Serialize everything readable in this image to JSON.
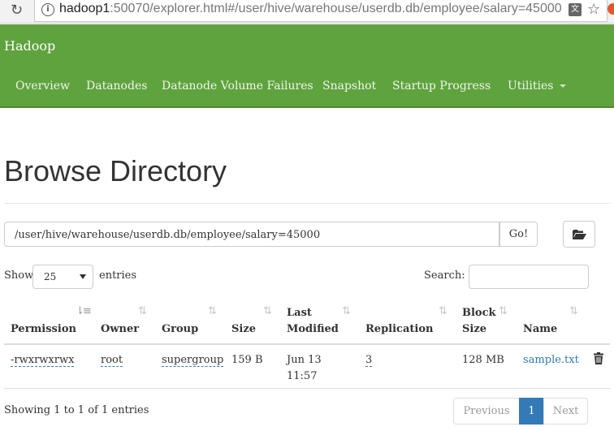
{
  "browser": {
    "url_host": "hadoop1",
    "url_rest": ":50070/explorer.html#/user/hive/warehouse/userdb.db/employee/salary=45000",
    "translate_glyph": "文"
  },
  "navbar": {
    "brand": "Hadoop",
    "items": [
      "Overview",
      "Datanodes",
      "Datanode Volume Failures",
      "Snapshot",
      "Startup Progress",
      "Utilities"
    ]
  },
  "page": {
    "title": "Browse Directory",
    "path_value": "/user/hive/warehouse/userdb.db/employee/salary=45000",
    "go_label": "Go!"
  },
  "controls": {
    "show_label": "Show",
    "entries_value": "25",
    "entries_label": "entries",
    "search_label": "Search:"
  },
  "table": {
    "headers": {
      "permission": "Permission",
      "owner": "Owner",
      "group": "Group",
      "size": "Size",
      "last_modified_1": "Last",
      "last_modified_2": "Modified",
      "replication": "Replication",
      "block_size_1": "Block",
      "block_size_2": "Size",
      "name": "Name"
    },
    "rows": [
      {
        "permission": "-rwxrwxrwx",
        "owner": "root",
        "group": "supergroup",
        "size": "159 B",
        "modified_1": "Jun 13",
        "modified_2": "11:57",
        "replication": "3",
        "block_size": "128 MB",
        "name": "sample.txt"
      }
    ]
  },
  "footer": {
    "info": "Showing 1 to 1 of 1 entries",
    "previous": "Previous",
    "current_page": "1",
    "next": "Next"
  },
  "colors": {
    "navbar": "#5fa33e",
    "link": "#337ab7",
    "pager_active": "#337ab7"
  }
}
